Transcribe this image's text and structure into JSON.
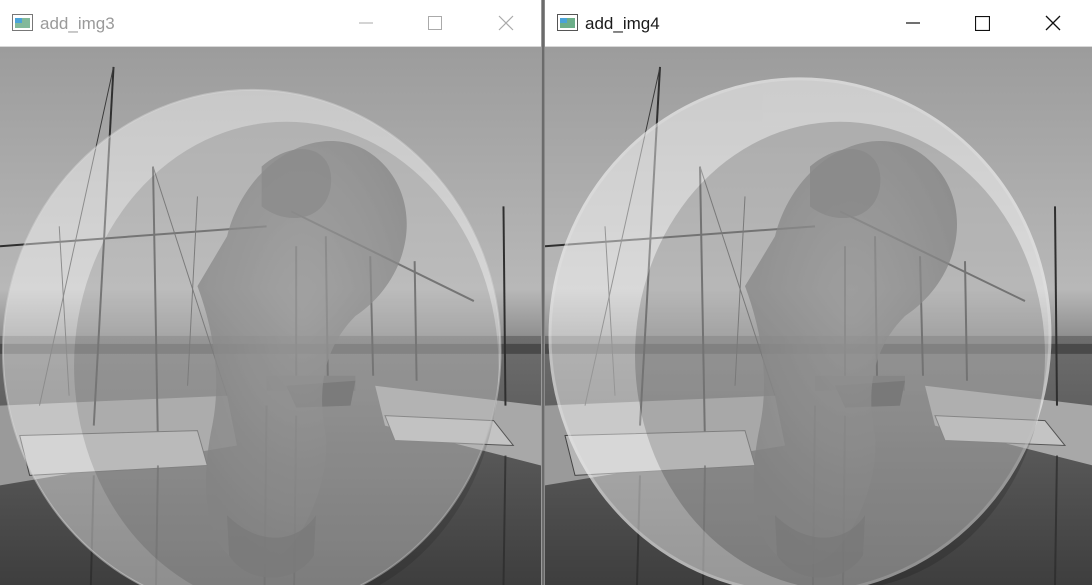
{
  "windows": [
    {
      "id": "left",
      "title": "add_img3",
      "state": "inactive",
      "image": {
        "description_icon": "blended-grayscale-image",
        "overlay_opacity": 0.42
      }
    },
    {
      "id": "right",
      "title": "add_img4",
      "state": "active",
      "image": {
        "description_icon": "blended-grayscale-image",
        "overlay_opacity": 0.72
      }
    }
  ],
  "icons": {
    "app": "image-window-icon",
    "minimize": "minimize-icon",
    "maximize": "maximize-icon",
    "close": "close-icon"
  },
  "colors": {
    "title_inactive": "#9a9a9a",
    "title_active": "#1a1a1a",
    "titlebar_bg": "#ffffff"
  }
}
